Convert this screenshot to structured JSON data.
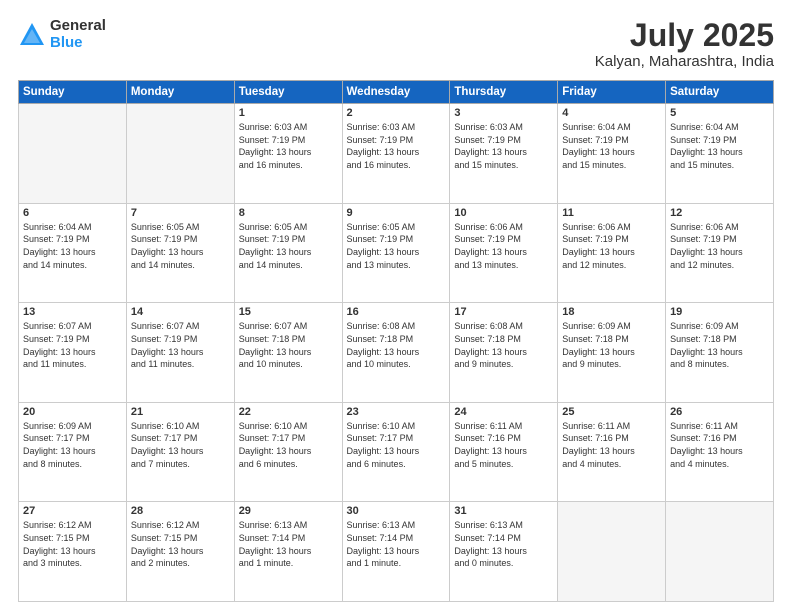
{
  "logo": {
    "general": "General",
    "blue": "Blue"
  },
  "title": "July 2025",
  "subtitle": "Kalyan, Maharashtra, India",
  "headers": [
    "Sunday",
    "Monday",
    "Tuesday",
    "Wednesday",
    "Thursday",
    "Friday",
    "Saturday"
  ],
  "weeks": [
    [
      {
        "day": "",
        "info": ""
      },
      {
        "day": "",
        "info": ""
      },
      {
        "day": "1",
        "info": "Sunrise: 6:03 AM\nSunset: 7:19 PM\nDaylight: 13 hours\nand 16 minutes."
      },
      {
        "day": "2",
        "info": "Sunrise: 6:03 AM\nSunset: 7:19 PM\nDaylight: 13 hours\nand 16 minutes."
      },
      {
        "day": "3",
        "info": "Sunrise: 6:03 AM\nSunset: 7:19 PM\nDaylight: 13 hours\nand 15 minutes."
      },
      {
        "day": "4",
        "info": "Sunrise: 6:04 AM\nSunset: 7:19 PM\nDaylight: 13 hours\nand 15 minutes."
      },
      {
        "day": "5",
        "info": "Sunrise: 6:04 AM\nSunset: 7:19 PM\nDaylight: 13 hours\nand 15 minutes."
      }
    ],
    [
      {
        "day": "6",
        "info": "Sunrise: 6:04 AM\nSunset: 7:19 PM\nDaylight: 13 hours\nand 14 minutes."
      },
      {
        "day": "7",
        "info": "Sunrise: 6:05 AM\nSunset: 7:19 PM\nDaylight: 13 hours\nand 14 minutes."
      },
      {
        "day": "8",
        "info": "Sunrise: 6:05 AM\nSunset: 7:19 PM\nDaylight: 13 hours\nand 14 minutes."
      },
      {
        "day": "9",
        "info": "Sunrise: 6:05 AM\nSunset: 7:19 PM\nDaylight: 13 hours\nand 13 minutes."
      },
      {
        "day": "10",
        "info": "Sunrise: 6:06 AM\nSunset: 7:19 PM\nDaylight: 13 hours\nand 13 minutes."
      },
      {
        "day": "11",
        "info": "Sunrise: 6:06 AM\nSunset: 7:19 PM\nDaylight: 13 hours\nand 12 minutes."
      },
      {
        "day": "12",
        "info": "Sunrise: 6:06 AM\nSunset: 7:19 PM\nDaylight: 13 hours\nand 12 minutes."
      }
    ],
    [
      {
        "day": "13",
        "info": "Sunrise: 6:07 AM\nSunset: 7:19 PM\nDaylight: 13 hours\nand 11 minutes."
      },
      {
        "day": "14",
        "info": "Sunrise: 6:07 AM\nSunset: 7:19 PM\nDaylight: 13 hours\nand 11 minutes."
      },
      {
        "day": "15",
        "info": "Sunrise: 6:07 AM\nSunset: 7:18 PM\nDaylight: 13 hours\nand 10 minutes."
      },
      {
        "day": "16",
        "info": "Sunrise: 6:08 AM\nSunset: 7:18 PM\nDaylight: 13 hours\nand 10 minutes."
      },
      {
        "day": "17",
        "info": "Sunrise: 6:08 AM\nSunset: 7:18 PM\nDaylight: 13 hours\nand 9 minutes."
      },
      {
        "day": "18",
        "info": "Sunrise: 6:09 AM\nSunset: 7:18 PM\nDaylight: 13 hours\nand 9 minutes."
      },
      {
        "day": "19",
        "info": "Sunrise: 6:09 AM\nSunset: 7:18 PM\nDaylight: 13 hours\nand 8 minutes."
      }
    ],
    [
      {
        "day": "20",
        "info": "Sunrise: 6:09 AM\nSunset: 7:17 PM\nDaylight: 13 hours\nand 8 minutes."
      },
      {
        "day": "21",
        "info": "Sunrise: 6:10 AM\nSunset: 7:17 PM\nDaylight: 13 hours\nand 7 minutes."
      },
      {
        "day": "22",
        "info": "Sunrise: 6:10 AM\nSunset: 7:17 PM\nDaylight: 13 hours\nand 6 minutes."
      },
      {
        "day": "23",
        "info": "Sunrise: 6:10 AM\nSunset: 7:17 PM\nDaylight: 13 hours\nand 6 minutes."
      },
      {
        "day": "24",
        "info": "Sunrise: 6:11 AM\nSunset: 7:16 PM\nDaylight: 13 hours\nand 5 minutes."
      },
      {
        "day": "25",
        "info": "Sunrise: 6:11 AM\nSunset: 7:16 PM\nDaylight: 13 hours\nand 4 minutes."
      },
      {
        "day": "26",
        "info": "Sunrise: 6:11 AM\nSunset: 7:16 PM\nDaylight: 13 hours\nand 4 minutes."
      }
    ],
    [
      {
        "day": "27",
        "info": "Sunrise: 6:12 AM\nSunset: 7:15 PM\nDaylight: 13 hours\nand 3 minutes."
      },
      {
        "day": "28",
        "info": "Sunrise: 6:12 AM\nSunset: 7:15 PM\nDaylight: 13 hours\nand 2 minutes."
      },
      {
        "day": "29",
        "info": "Sunrise: 6:13 AM\nSunset: 7:14 PM\nDaylight: 13 hours\nand 1 minute."
      },
      {
        "day": "30",
        "info": "Sunrise: 6:13 AM\nSunset: 7:14 PM\nDaylight: 13 hours\nand 1 minute."
      },
      {
        "day": "31",
        "info": "Sunrise: 6:13 AM\nSunset: 7:14 PM\nDaylight: 13 hours\nand 0 minutes."
      },
      {
        "day": "",
        "info": ""
      },
      {
        "day": "",
        "info": ""
      }
    ]
  ]
}
